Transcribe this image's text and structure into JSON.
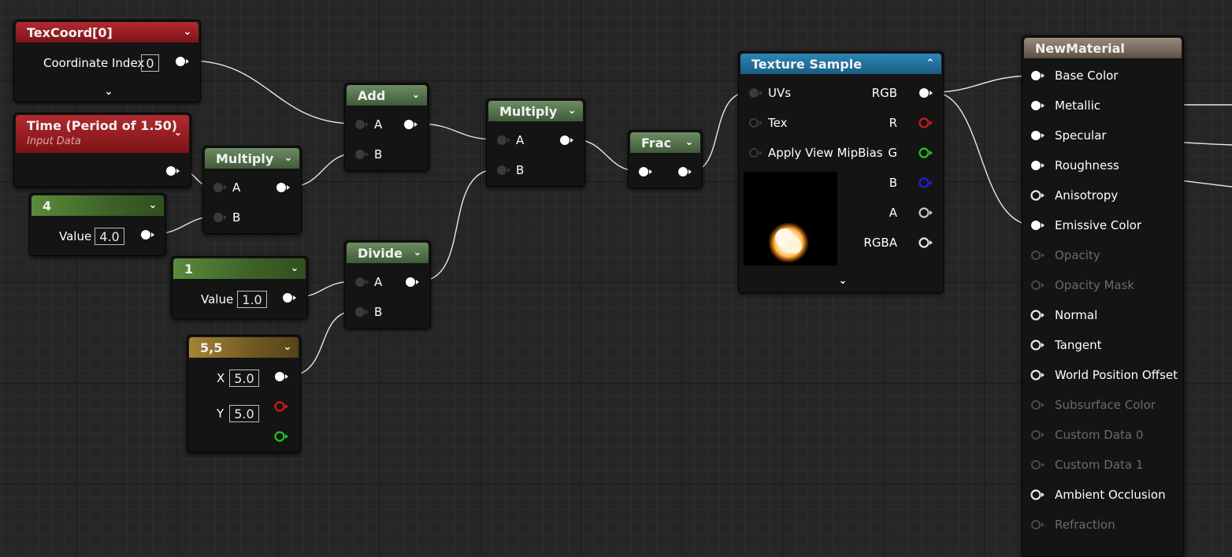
{
  "nodes": {
    "texcoord": {
      "title": "TexCoord[0]",
      "coord_label": "Coordinate Index",
      "coord_value": "0"
    },
    "time": {
      "title": "Time (Period of 1.50)",
      "subtitle": "Input Data"
    },
    "const4": {
      "title": "4",
      "value_label": "Value",
      "value": "4.0"
    },
    "multiply1": {
      "title": "Multiply",
      "pin_a": "A",
      "pin_b": "B"
    },
    "add": {
      "title": "Add",
      "pin_a": "A",
      "pin_b": "B"
    },
    "const1": {
      "title": "1",
      "value_label": "Value",
      "value": "1.0"
    },
    "divide": {
      "title": "Divide",
      "pin_a": "A",
      "pin_b": "B"
    },
    "vec55": {
      "title": "5,5",
      "x_label": "X",
      "x_value": "5.0",
      "y_label": "Y",
      "y_value": "5.0"
    },
    "multiply2": {
      "title": "Multiply",
      "pin_a": "A",
      "pin_b": "B"
    },
    "frac": {
      "title": "Frac"
    },
    "texture": {
      "title": "Texture Sample",
      "inputs": [
        "UVs",
        "Tex",
        "Apply View MipBias"
      ],
      "outputs": [
        "RGB",
        "R",
        "G",
        "B",
        "A",
        "RGBA"
      ]
    },
    "material": {
      "title": "NewMaterial",
      "inputs": [
        "Base Color",
        "Metallic",
        "Specular",
        "Roughness",
        "Anisotropy",
        "Emissive Color",
        "Opacity",
        "Opacity Mask",
        "Normal",
        "Tangent",
        "World Position Offset",
        "Subsurface Color",
        "Custom Data 0",
        "Custom Data 1",
        "Ambient Occlusion",
        "Refraction"
      ]
    }
  },
  "colors": {
    "wire": "#e8e8e8",
    "pin_red": "#d11a1a",
    "pin_green": "#1fc91f",
    "pin_blue": "#2020e0",
    "grid_bg": "#262626"
  }
}
